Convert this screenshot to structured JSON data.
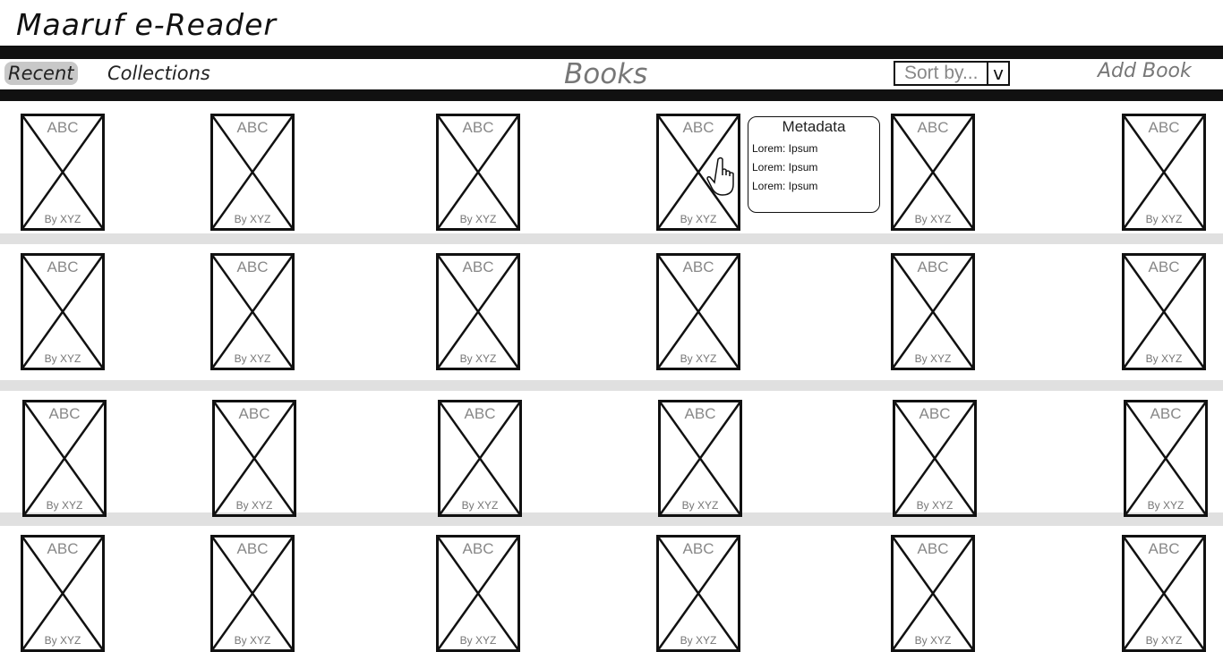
{
  "app": {
    "title": "Maaruf e-Reader"
  },
  "nav": {
    "recent": "Recent",
    "collections": "Collections",
    "active": "Recent"
  },
  "header": {
    "books_heading": "Books",
    "sort_placeholder": "Sort by...",
    "sort_caret": "v",
    "add_book": "Add Book"
  },
  "books": [
    [
      {
        "title": "ABC",
        "author": "By XYZ"
      },
      {
        "title": "ABC",
        "author": "By XYZ"
      },
      {
        "title": "ABC",
        "author": "By XYZ"
      },
      {
        "title": "ABC",
        "author": "By XYZ"
      },
      {
        "title": "ABC",
        "author": "By XYZ"
      },
      {
        "title": "ABC",
        "author": "By XYZ"
      }
    ],
    [
      {
        "title": "ABC",
        "author": "By XYZ"
      },
      {
        "title": "ABC",
        "author": "By XYZ"
      },
      {
        "title": "ABC",
        "author": "By XYZ"
      },
      {
        "title": "ABC",
        "author": "By XYZ"
      },
      {
        "title": "ABC",
        "author": "By XYZ"
      },
      {
        "title": "ABC",
        "author": "By XYZ"
      }
    ],
    [
      {
        "title": "ABC",
        "author": "By XYZ"
      },
      {
        "title": "ABC",
        "author": "By XYZ"
      },
      {
        "title": "ABC",
        "author": "By XYZ"
      },
      {
        "title": "ABC",
        "author": "By XYZ"
      },
      {
        "title": "ABC",
        "author": "By XYZ"
      },
      {
        "title": "ABC",
        "author": "By XYZ"
      }
    ],
    [
      {
        "title": "ABC",
        "author": "By XYZ"
      },
      {
        "title": "ABC",
        "author": "By XYZ"
      },
      {
        "title": "ABC",
        "author": "By XYZ"
      },
      {
        "title": "ABC",
        "author": "By XYZ"
      },
      {
        "title": "ABC",
        "author": "By XYZ"
      },
      {
        "title": "ABC",
        "author": "By XYZ"
      }
    ]
  ],
  "metadata_popup": {
    "title": "Metadata",
    "rows": [
      "Lorem: Ipsum",
      "Lorem: Ipsum",
      "Lorem: Ipsum"
    ]
  },
  "cursor": {
    "icon": "hand-pointer-icon"
  }
}
